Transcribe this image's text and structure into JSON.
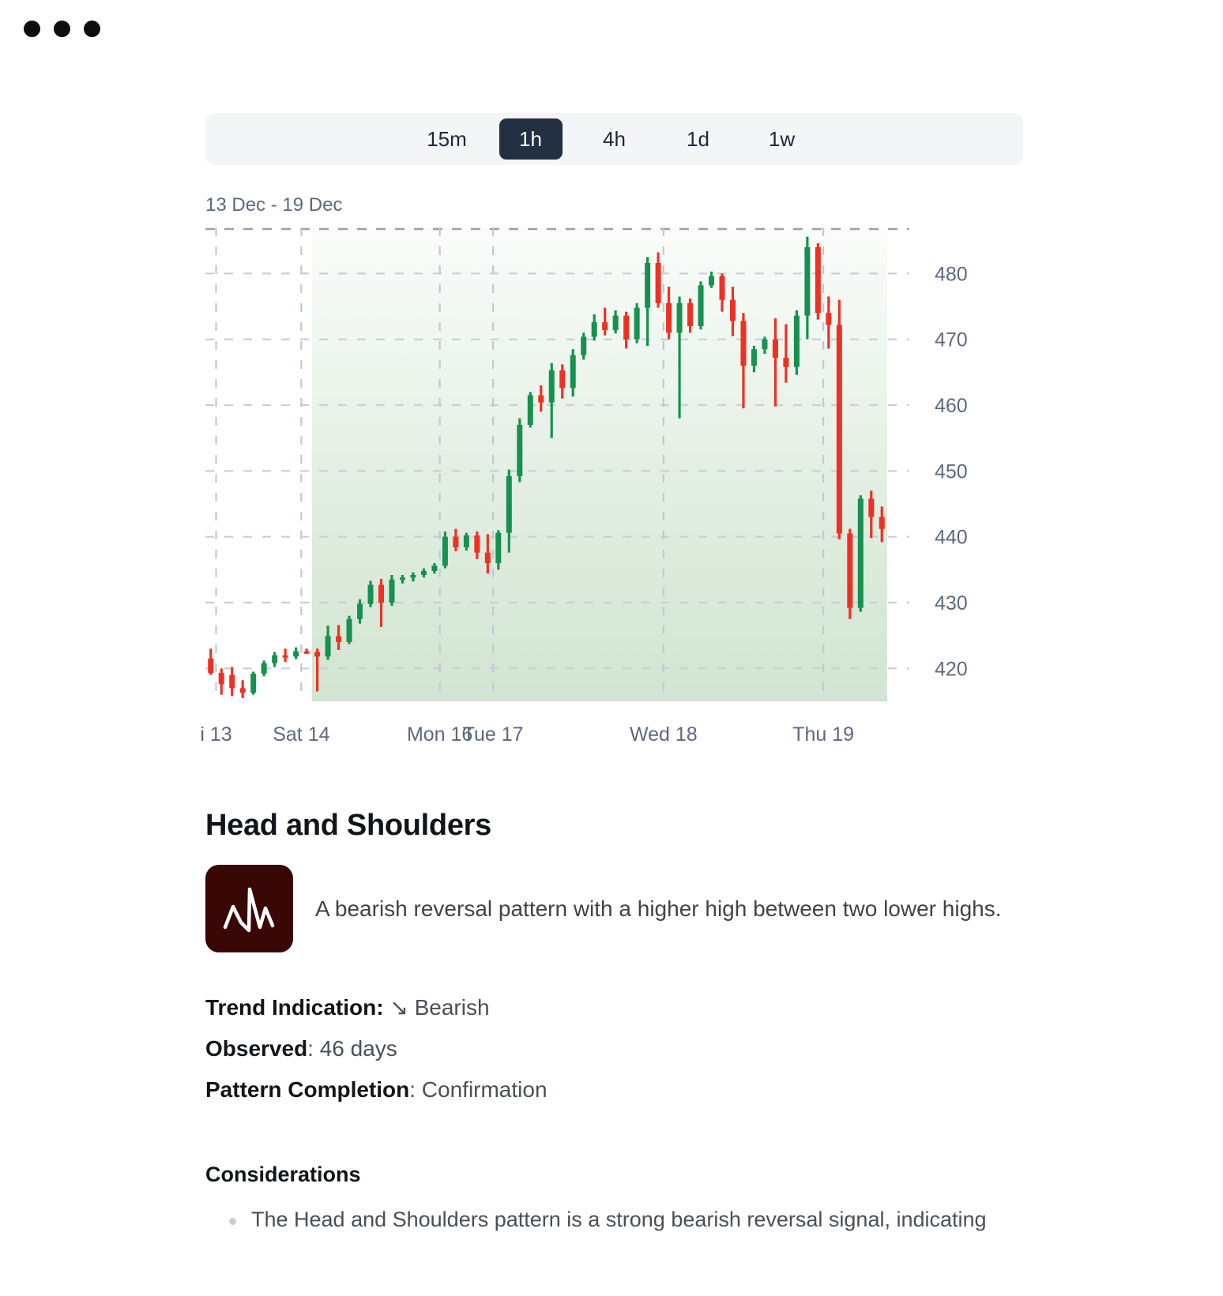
{
  "window": {
    "dots": 3
  },
  "timeframe": {
    "options": [
      {
        "label": "15m",
        "active": false
      },
      {
        "label": "1h",
        "active": true
      },
      {
        "label": "4h",
        "active": false
      },
      {
        "label": "1d",
        "active": false
      },
      {
        "label": "1w",
        "active": false
      }
    ]
  },
  "chart": {
    "range_label": "13 Dec - 19 Dec"
  },
  "pattern": {
    "title": "Head and Shoulders",
    "icon_name": "head-and-shoulders-icon",
    "icon_bg": "#3a0707",
    "description": "A bearish reversal pattern with a higher high between two lower highs.",
    "trend_label": "Trend Indication:",
    "trend_arrow": "↘",
    "trend_value": "Bearish",
    "observed_label": "Observed",
    "observed_value": ": 46 days",
    "completion_label": "Pattern Completion",
    "completion_value": ": Confirmation"
  },
  "considerations": {
    "title": "Considerations",
    "items": [
      "The Head and Shoulders pattern is a strong bearish reversal signal, indicating"
    ]
  },
  "chart_data": {
    "type": "candlestick",
    "title": "13 Dec - 19 Dec",
    "xlabel": "",
    "ylabel": "",
    "ylim": [
      415,
      487
    ],
    "yticks": [
      420,
      430,
      440,
      450,
      460,
      470,
      480
    ],
    "grid": true,
    "xtick_labels": [
      "i 13",
      "Sat 14",
      "Mon 16",
      "Tue 17",
      "Wed 18",
      "Thu 19"
    ],
    "xtick_positions": [
      0.5,
      8.5,
      21.5,
      26.5,
      42.5,
      57.5
    ],
    "bull_color": "#17914f",
    "bear_color": "#ee3123",
    "highlight_region": {
      "start_index": 10,
      "end_index": 63,
      "color": "#cfe3cf"
    },
    "candles": [
      {
        "o": 421.5,
        "h": 423.0,
        "l": 419.0,
        "c": 419.3
      },
      {
        "o": 419.3,
        "h": 420.0,
        "l": 416.0,
        "c": 417.6
      },
      {
        "o": 419.0,
        "h": 420.2,
        "l": 415.8,
        "c": 417.0
      },
      {
        "o": 417.0,
        "h": 418.2,
        "l": 415.5,
        "c": 416.3
      },
      {
        "o": 416.3,
        "h": 419.5,
        "l": 416.0,
        "c": 419.2
      },
      {
        "o": 419.2,
        "h": 421.2,
        "l": 418.8,
        "c": 420.8
      },
      {
        "o": 420.8,
        "h": 422.5,
        "l": 420.2,
        "c": 422.0
      },
      {
        "o": 422.0,
        "h": 423.0,
        "l": 421.0,
        "c": 421.8
      },
      {
        "o": 421.8,
        "h": 423.2,
        "l": 421.4,
        "c": 422.6
      },
      {
        "o": 422.6,
        "h": 423.0,
        "l": 422.2,
        "c": 422.5
      },
      {
        "o": 422.5,
        "h": 423.0,
        "l": 416.5,
        "c": 421.8
      },
      {
        "o": 421.8,
        "h": 426.5,
        "l": 421.3,
        "c": 424.9
      },
      {
        "o": 424.9,
        "h": 426.6,
        "l": 422.8,
        "c": 424.0
      },
      {
        "o": 424.0,
        "h": 428.0,
        "l": 423.7,
        "c": 427.5
      },
      {
        "o": 427.5,
        "h": 430.5,
        "l": 426.8,
        "c": 429.8
      },
      {
        "o": 429.8,
        "h": 433.3,
        "l": 429.3,
        "c": 432.7
      },
      {
        "o": 432.7,
        "h": 433.6,
        "l": 426.3,
        "c": 430.0
      },
      {
        "o": 430.0,
        "h": 434.2,
        "l": 429.5,
        "c": 433.5
      },
      {
        "o": 433.5,
        "h": 434.2,
        "l": 432.9,
        "c": 433.8
      },
      {
        "o": 433.8,
        "h": 434.6,
        "l": 433.2,
        "c": 434.2
      },
      {
        "o": 434.2,
        "h": 435.2,
        "l": 433.8,
        "c": 434.8
      },
      {
        "o": 434.8,
        "h": 436.0,
        "l": 434.4,
        "c": 435.6
      },
      {
        "o": 435.6,
        "h": 440.8,
        "l": 435.2,
        "c": 440.0
      },
      {
        "o": 440.0,
        "h": 441.2,
        "l": 437.8,
        "c": 438.4
      },
      {
        "o": 438.4,
        "h": 440.6,
        "l": 437.9,
        "c": 440.2
      },
      {
        "o": 440.2,
        "h": 440.8,
        "l": 436.6,
        "c": 437.6
      },
      {
        "o": 437.6,
        "h": 440.4,
        "l": 434.4,
        "c": 436.0
      },
      {
        "o": 436.0,
        "h": 441.0,
        "l": 435.0,
        "c": 440.6
      },
      {
        "o": 440.6,
        "h": 450.2,
        "l": 437.6,
        "c": 449.2
      },
      {
        "o": 449.2,
        "h": 458.0,
        "l": 448.3,
        "c": 457.0
      },
      {
        "o": 457.0,
        "h": 462.0,
        "l": 456.6,
        "c": 461.5
      },
      {
        "o": 461.5,
        "h": 463.0,
        "l": 459.0,
        "c": 460.4
      },
      {
        "o": 460.4,
        "h": 466.4,
        "l": 455.0,
        "c": 465.3
      },
      {
        "o": 465.3,
        "h": 466.2,
        "l": 461.0,
        "c": 462.6
      },
      {
        "o": 462.6,
        "h": 468.5,
        "l": 461.3,
        "c": 467.6
      },
      {
        "o": 467.6,
        "h": 471.0,
        "l": 466.9,
        "c": 470.4
      },
      {
        "o": 470.4,
        "h": 473.8,
        "l": 469.8,
        "c": 472.6
      },
      {
        "o": 472.6,
        "h": 474.8,
        "l": 470.6,
        "c": 471.4
      },
      {
        "o": 471.4,
        "h": 474.4,
        "l": 470.9,
        "c": 473.6
      },
      {
        "o": 473.6,
        "h": 474.2,
        "l": 468.6,
        "c": 470.0
      },
      {
        "o": 470.0,
        "h": 475.5,
        "l": 469.4,
        "c": 474.8
      },
      {
        "o": 474.8,
        "h": 482.5,
        "l": 469.0,
        "c": 481.6
      },
      {
        "o": 481.6,
        "h": 483.2,
        "l": 474.8,
        "c": 475.5
      },
      {
        "o": 475.5,
        "h": 478.0,
        "l": 470.0,
        "c": 471.0
      },
      {
        "o": 471.0,
        "h": 476.5,
        "l": 458.0,
        "c": 475.5
      },
      {
        "o": 475.5,
        "h": 476.2,
        "l": 471.0,
        "c": 472.0
      },
      {
        "o": 472.0,
        "h": 478.8,
        "l": 471.5,
        "c": 478.2
      },
      {
        "o": 478.2,
        "h": 480.3,
        "l": 477.8,
        "c": 479.6
      },
      {
        "o": 479.6,
        "h": 480.0,
        "l": 474.2,
        "c": 476.0
      },
      {
        "o": 476.0,
        "h": 478.0,
        "l": 470.5,
        "c": 472.8
      },
      {
        "o": 472.8,
        "h": 474.0,
        "l": 459.5,
        "c": 466.0
      },
      {
        "o": 466.0,
        "h": 469.0,
        "l": 465.0,
        "c": 468.5
      },
      {
        "o": 468.5,
        "h": 470.4,
        "l": 467.8,
        "c": 470.0
      },
      {
        "o": 470.0,
        "h": 473.2,
        "l": 459.8,
        "c": 467.2
      },
      {
        "o": 467.2,
        "h": 472.3,
        "l": 463.4,
        "c": 465.8
      },
      {
        "o": 465.8,
        "h": 474.4,
        "l": 464.6,
        "c": 473.6
      },
      {
        "o": 473.6,
        "h": 485.6,
        "l": 470.0,
        "c": 484.0
      },
      {
        "o": 484.0,
        "h": 484.6,
        "l": 473.0,
        "c": 474.0
      },
      {
        "o": 474.0,
        "h": 476.5,
        "l": 468.6,
        "c": 472.2
      },
      {
        "o": 472.2,
        "h": 476.0,
        "l": 439.6,
        "c": 440.5
      },
      {
        "o": 440.5,
        "h": 441.2,
        "l": 427.5,
        "c": 429.2
      },
      {
        "o": 429.2,
        "h": 446.3,
        "l": 428.6,
        "c": 445.8
      },
      {
        "o": 445.8,
        "h": 447.0,
        "l": 439.8,
        "c": 443.0
      },
      {
        "o": 443.0,
        "h": 444.6,
        "l": 439.2,
        "c": 441.2
      }
    ]
  }
}
